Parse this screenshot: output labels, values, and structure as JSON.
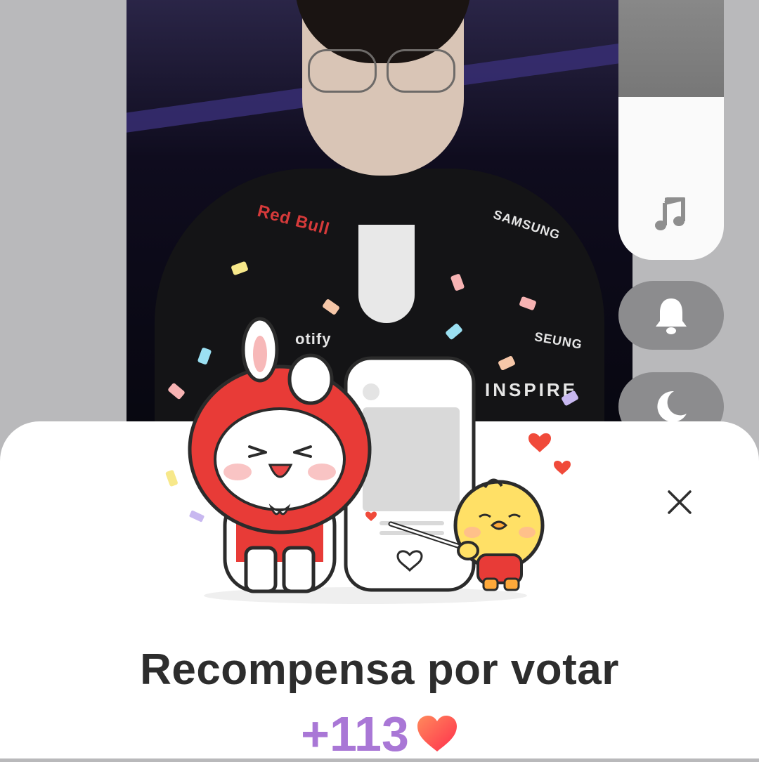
{
  "background_photo": {
    "jacket_logos": [
      "Red Bull",
      "SAMSUNG",
      "otify",
      "INSPIRE",
      "SEUNG"
    ]
  },
  "side_controls": {
    "music": "music-note-icon",
    "notification": "bell-icon",
    "night_mode": "moon-icon"
  },
  "popup": {
    "close_icon": "close-icon",
    "title": "Recompensa por votar",
    "reward_amount": "+113",
    "reward_icon": "heart-icon"
  },
  "colors": {
    "accent_purple": "#a977d6",
    "heart_red": "#ff4b3e",
    "side_button_gray": "#8c8c8e"
  }
}
